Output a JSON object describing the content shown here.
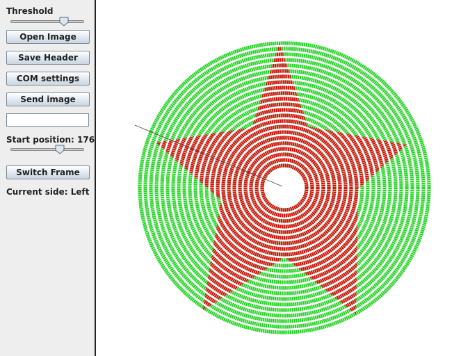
{
  "controls": {
    "threshold_label": "Threshold",
    "threshold_level": 0.76,
    "open_image": "Open Image",
    "save_header": "Save Header",
    "com_settings": "COM settings",
    "send_image": "Send image",
    "text_field_value": "",
    "start_position_label": "Start position: 176",
    "start_position_level": 0.7,
    "switch_frame": "Switch Frame",
    "current_side_label": "Current side: Left"
  },
  "colors": {
    "ring_outer": "#2ad52a",
    "ring_inner": "#d81414",
    "panel_bg": "#eeeeee",
    "canvas_bg": "#ffffff"
  }
}
